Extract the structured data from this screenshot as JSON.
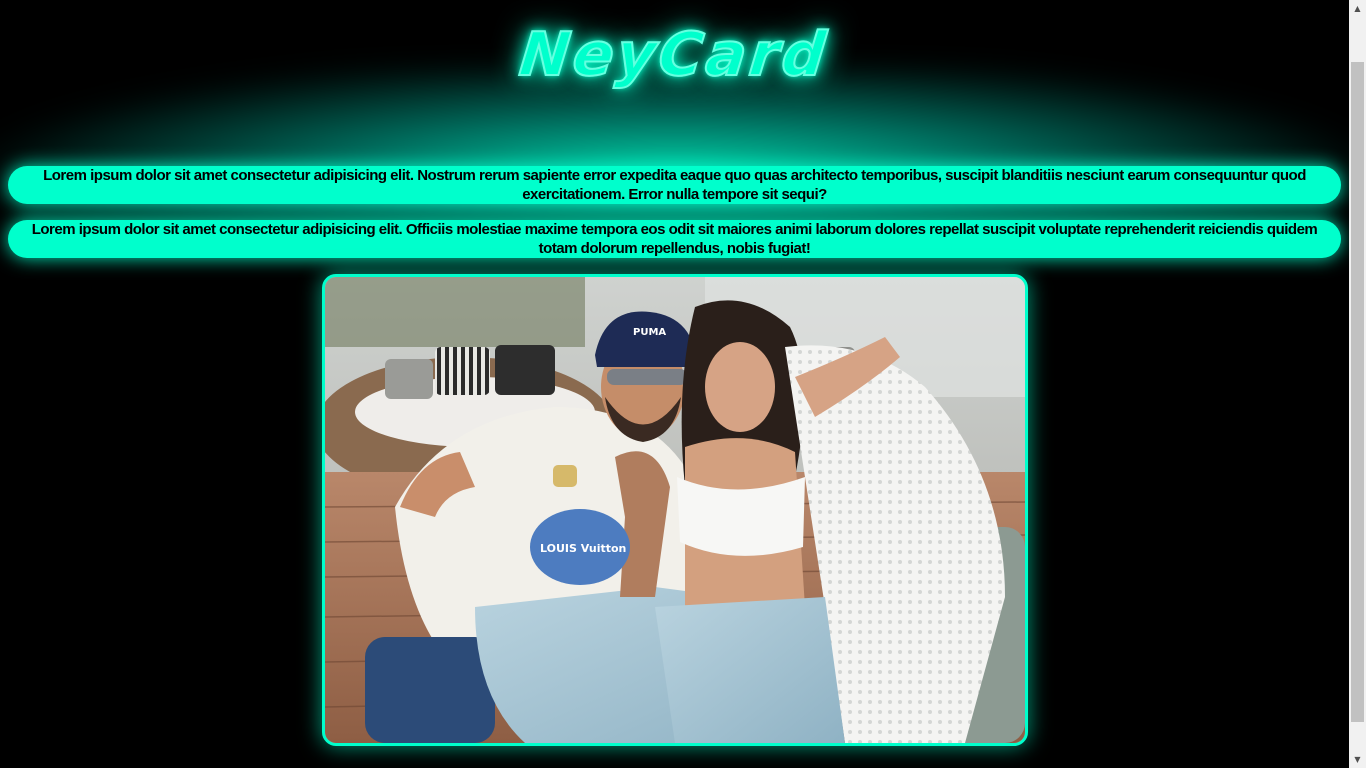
{
  "header": {
    "title": "NeyCard"
  },
  "content": {
    "paragraph_1": "Lorem ipsum dolor sit amet consectetur adipisicing elit. Nostrum rerum sapiente error expedita eaque quo quas architecto temporibus, suscipit blanditiis nesciunt earum consequuntur quod exercitationem. Error nulla tempore sit sequi?",
    "paragraph_2": "Lorem ipsum dolor sit amet consectetur adipisicing elit. Officiis molestiae maxime tempora eos odit sit maiores animi laborum dolores repellat suscipit voluptate reprehenderit reiciendis quidem totam dolorum repellendus, nobis fugiat!"
  },
  "photo": {
    "cap_logo_text": "PUMA",
    "shirt_print_text": "LOUIS Vuitton"
  },
  "colors": {
    "accent": "#00ffcc",
    "background": "#000000",
    "text_on_accent": "#000000"
  },
  "scrollbar": {
    "up_icon": "arrow-up-icon",
    "down_icon": "arrow-down-icon"
  }
}
